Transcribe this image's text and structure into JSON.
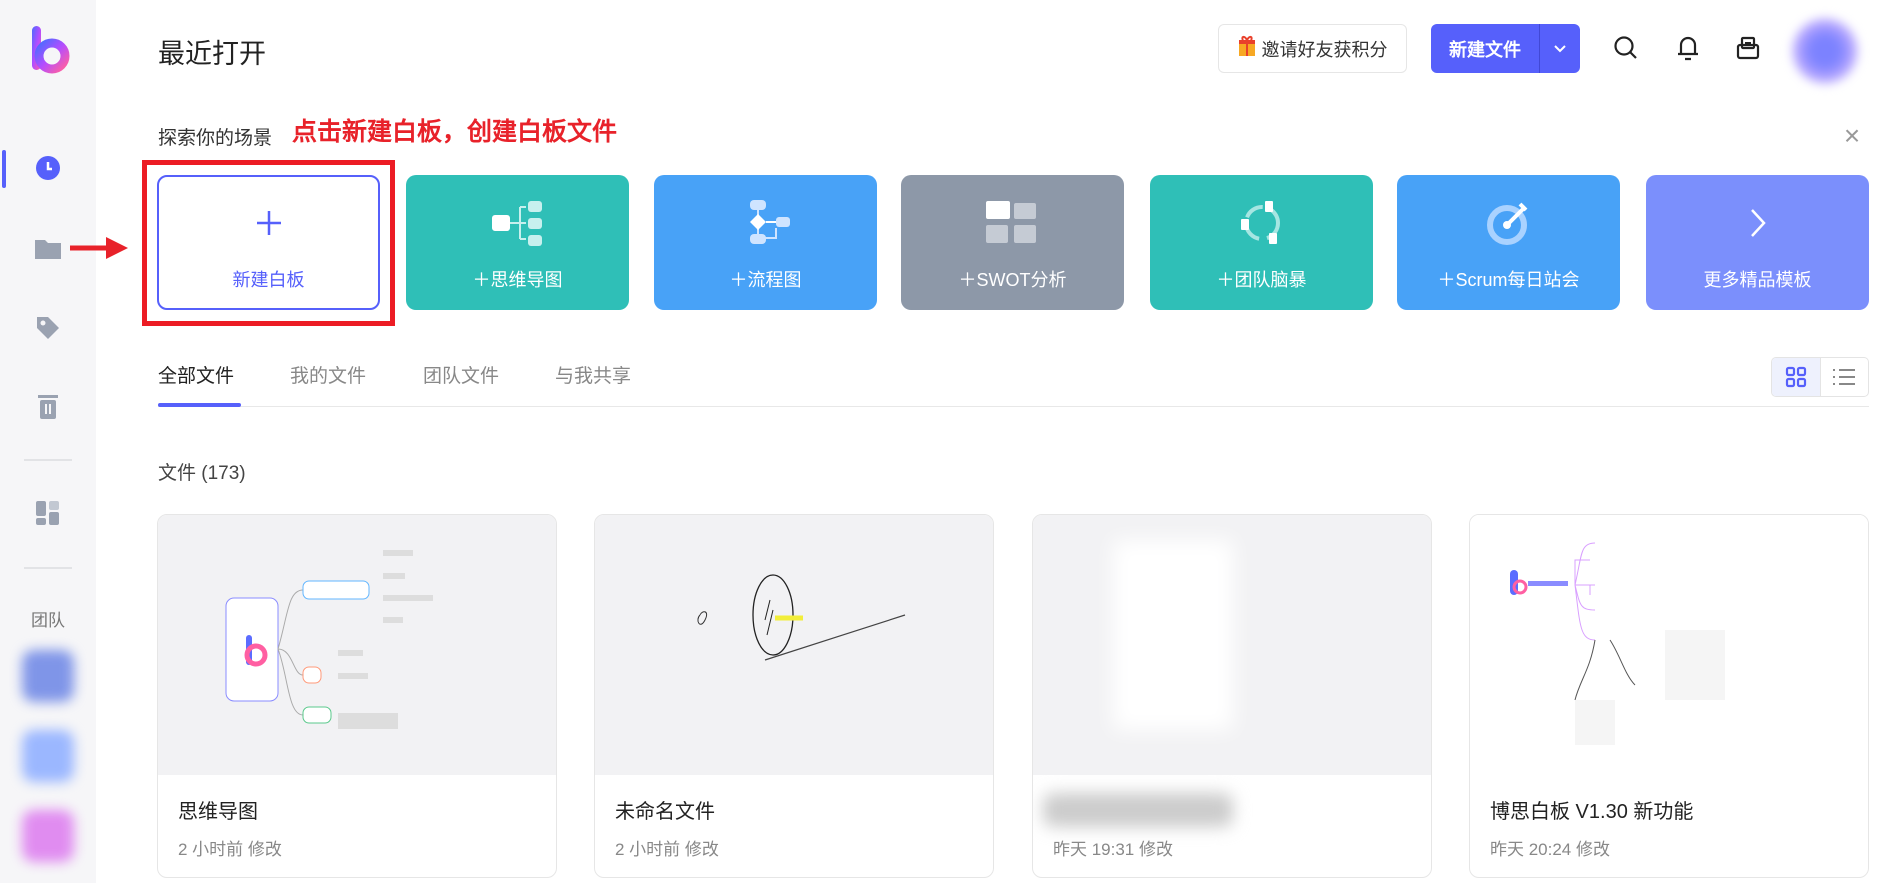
{
  "sidebar": {
    "team_label": "团队",
    "icons": [
      "logo",
      "clock-icon",
      "folder-icon",
      "tag-icon",
      "trash-icon",
      "templates-icon"
    ]
  },
  "header": {
    "title": "最近打开",
    "invite_label": "邀请好友获积分",
    "new_file_label": "新建文件"
  },
  "explore": {
    "title": "探索你的场景",
    "annotation": "点击新建白板，创建白板文件",
    "cards": [
      {
        "label": "新建白板",
        "color": "#ffffff"
      },
      {
        "label": "＋思维导图",
        "color": "#2fbfb7"
      },
      {
        "label": "＋流程图",
        "color": "#48a2f7"
      },
      {
        "label": "＋SWOT分析",
        "color": "#8d98a8"
      },
      {
        "label": "＋团队脑暴",
        "color": "#2fbfb7"
      },
      {
        "label": "＋Scrum每日站会",
        "color": "#48a2f7"
      },
      {
        "label": "更多精品模板",
        "color": "#7b8ffc"
      }
    ]
  },
  "tabs": [
    "全部文件",
    "我的文件",
    "团队文件",
    "与我共享"
  ],
  "files": {
    "count_label": "文件 (173)",
    "items": [
      {
        "name": "思维导图",
        "meta": "2 小时前 修改"
      },
      {
        "name": "未命名文件",
        "meta": "2 小时前 修改"
      },
      {
        "name": "",
        "meta": "昨天 19:31 修改"
      },
      {
        "name": "博思白板 V1.30 新功能",
        "meta": "昨天 20:24 修改"
      }
    ]
  },
  "colors": {
    "accent": "#5660fb",
    "annotation": "#e8222a"
  }
}
